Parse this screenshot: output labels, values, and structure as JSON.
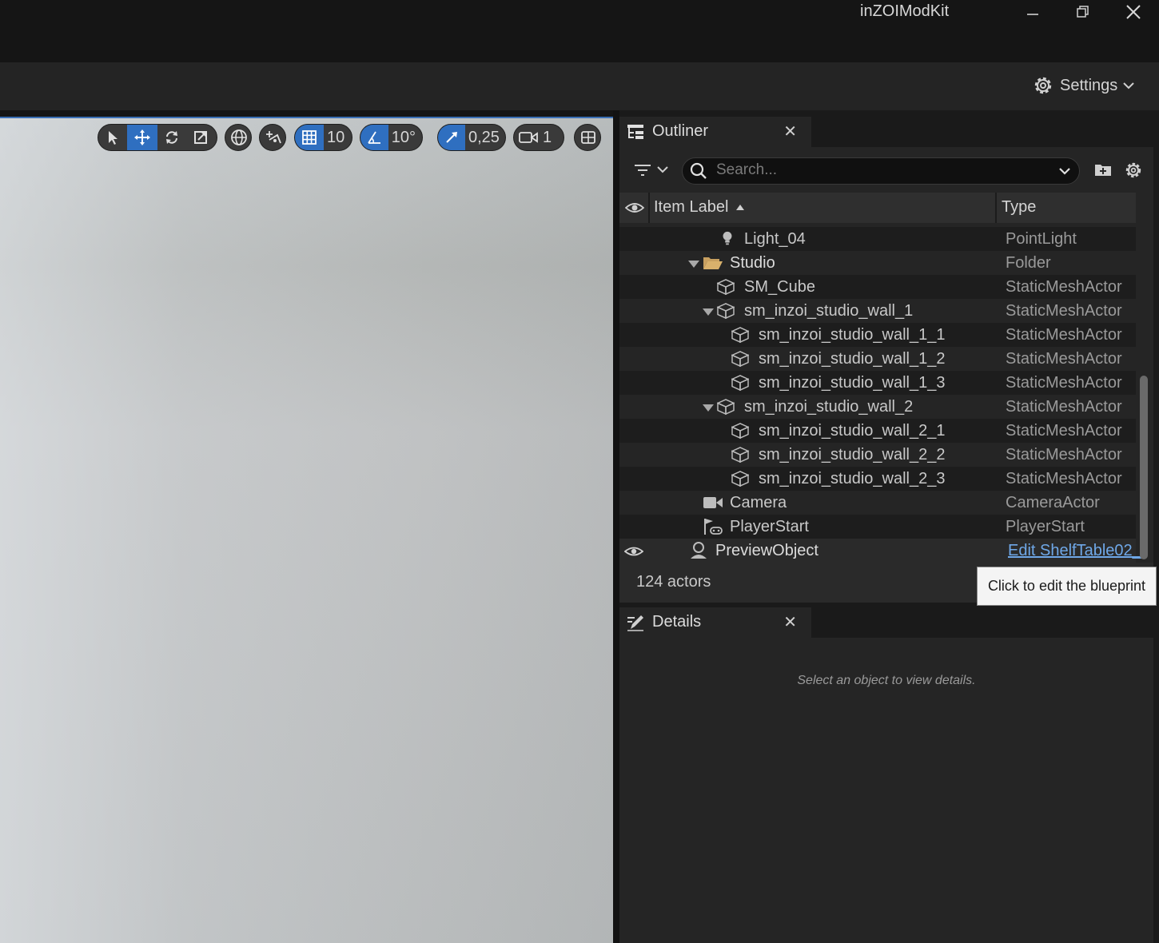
{
  "window": {
    "title": "inZOIModKit"
  },
  "toolbar": {
    "settings_label": "Settings"
  },
  "viewport": {
    "grid_snap": "10",
    "rotation_snap": "10°",
    "scale_snap": "0,25",
    "camera_speed": "1"
  },
  "outliner": {
    "tab_label": "Outliner",
    "search_placeholder": "Search...",
    "columns": {
      "label": "Item Label",
      "type": "Type"
    },
    "rows": [
      {
        "label": "Light_04",
        "type": "PointLight"
      },
      {
        "label": "Studio",
        "type": "Folder"
      },
      {
        "label": "SM_Cube",
        "type": "StaticMeshActor"
      },
      {
        "label": "sm_inzoi_studio_wall_1",
        "type": "StaticMeshActor"
      },
      {
        "label": "sm_inzoi_studio_wall_1_1",
        "type": "StaticMeshActor"
      },
      {
        "label": "sm_inzoi_studio_wall_1_2",
        "type": "StaticMeshActor"
      },
      {
        "label": "sm_inzoi_studio_wall_1_3",
        "type": "StaticMeshActor"
      },
      {
        "label": "sm_inzoi_studio_wall_2",
        "type": "StaticMeshActor"
      },
      {
        "label": "sm_inzoi_studio_wall_2_1",
        "type": "StaticMeshActor"
      },
      {
        "label": "sm_inzoi_studio_wall_2_2",
        "type": "StaticMeshActor"
      },
      {
        "label": "sm_inzoi_studio_wall_2_3",
        "type": "StaticMeshActor"
      },
      {
        "label": "Camera",
        "type": "CameraActor"
      },
      {
        "label": "PlayerStart",
        "type": "PlayerStart"
      },
      {
        "label": "PreviewObject",
        "type": "Edit ShelfTable02_"
      }
    ],
    "actor_count": "124 actors",
    "tooltip": "Click to edit the blueprint"
  },
  "details": {
    "tab_label": "Details",
    "empty_message": "Select an object to view details."
  },
  "colors": {
    "accent": "#2f6fc0",
    "link": "#6fa8e8",
    "folder": "#c8a060"
  }
}
